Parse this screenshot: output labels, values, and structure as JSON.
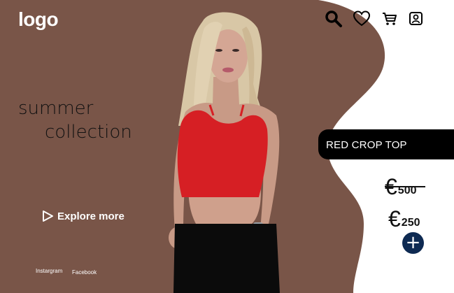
{
  "header": {
    "logo": "logo",
    "icons": [
      "search-icon",
      "heart-icon",
      "cart-icon",
      "account-icon"
    ]
  },
  "hero": {
    "line1": "summer",
    "line2": "collection",
    "explore_label": "Explore more"
  },
  "socials": {
    "instagram": "Instargram",
    "facebook": "Facebook"
  },
  "product": {
    "name": "RED CROP TOP",
    "currency": "€",
    "old_price": "500",
    "new_price": "250",
    "add_label": "+"
  },
  "colors": {
    "brown": "#795548",
    "pill": "#000000",
    "add_button": "#0e2a52",
    "top": "#d61f24"
  }
}
